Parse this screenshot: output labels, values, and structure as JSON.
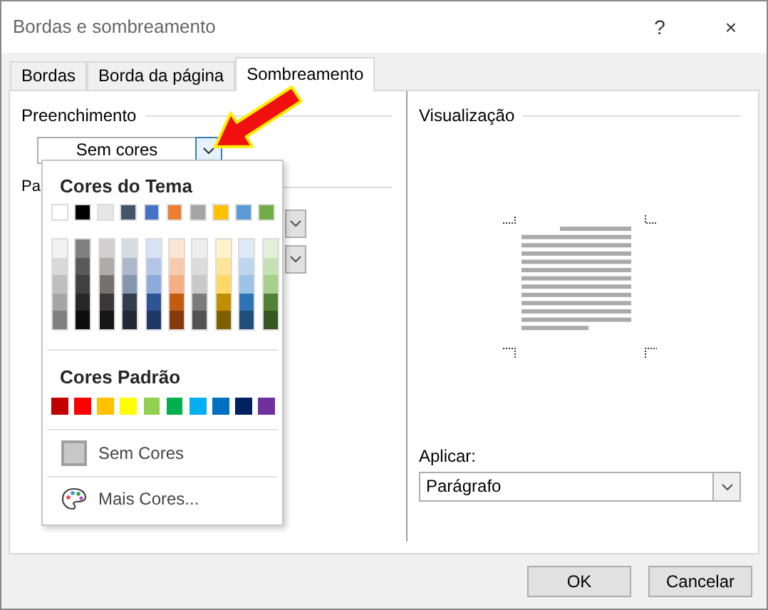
{
  "window": {
    "title": "Bordas e sombreamento",
    "help": "?",
    "close": "×"
  },
  "tabs": [
    {
      "label": "Bordas",
      "selected": false
    },
    {
      "label": "Borda da página",
      "selected": false
    },
    {
      "label": "Sombreamento",
      "selected": true
    }
  ],
  "fill": {
    "label": "Preenchimento",
    "value": "Sem cores",
    "expanded": true
  },
  "pattern": {
    "label": "Pa"
  },
  "color_menu": {
    "theme_heading": "Cores do Tema",
    "theme_colors": [
      {
        "color": "#ffffff",
        "shades": [
          {
            "color": "#f2f2f2"
          },
          {
            "color": "#d9d9d9"
          },
          {
            "color": "#bfbfbf"
          },
          {
            "color": "#a6a6a6"
          },
          {
            "color": "#808080"
          }
        ]
      },
      {
        "color": "#000000",
        "shades": [
          {
            "color": "#808080"
          },
          {
            "color": "#595959"
          },
          {
            "color": "#404040"
          },
          {
            "color": "#262626"
          },
          {
            "color": "#0d0d0d"
          }
        ]
      },
      {
        "color": "#e7e6e6",
        "shades": [
          {
            "color": "#d0cece"
          },
          {
            "color": "#aeabab"
          },
          {
            "color": "#757171"
          },
          {
            "color": "#3a3838"
          },
          {
            "color": "#171616"
          }
        ]
      },
      {
        "color": "#44546a",
        "shades": [
          {
            "color": "#d6dce4"
          },
          {
            "color": "#adb9ca"
          },
          {
            "color": "#8497b0"
          },
          {
            "color": "#333f4f"
          },
          {
            "color": "#222a35"
          }
        ]
      },
      {
        "color": "#4472c4",
        "shades": [
          {
            "color": "#d9e2f3"
          },
          {
            "color": "#b4c6e7"
          },
          {
            "color": "#8eaadb"
          },
          {
            "color": "#2f5496"
          },
          {
            "color": "#1f3864"
          }
        ]
      },
      {
        "color": "#ed7d31",
        "shades": [
          {
            "color": "#fbe5d5"
          },
          {
            "color": "#f7caac"
          },
          {
            "color": "#f4b083"
          },
          {
            "color": "#c55a11"
          },
          {
            "color": "#833c0b"
          }
        ]
      },
      {
        "color": "#a5a5a5",
        "shades": [
          {
            "color": "#ededed"
          },
          {
            "color": "#dbdbdb"
          },
          {
            "color": "#c9c9c9"
          },
          {
            "color": "#7b7b7b"
          },
          {
            "color": "#525252"
          }
        ]
      },
      {
        "color": "#ffc000",
        "shades": [
          {
            "color": "#fff2cc"
          },
          {
            "color": "#fee599"
          },
          {
            "color": "#ffd965"
          },
          {
            "color": "#bf8f00"
          },
          {
            "color": "#7f6000"
          }
        ]
      },
      {
        "color": "#5b9bd5",
        "shades": [
          {
            "color": "#deeaf6"
          },
          {
            "color": "#bdd6ee"
          },
          {
            "color": "#9cc3e5"
          },
          {
            "color": "#2e74b5"
          },
          {
            "color": "#1e4e79"
          }
        ]
      },
      {
        "color": "#70ad47",
        "shades": [
          {
            "color": "#e2efd9"
          },
          {
            "color": "#c5e0b3"
          },
          {
            "color": "#a8d08d"
          },
          {
            "color": "#538135"
          },
          {
            "color": "#375623"
          }
        ]
      }
    ],
    "standard_heading": "Cores Padrão",
    "standard_colors": [
      {
        "color": "#c00000"
      },
      {
        "color": "#ff0000"
      },
      {
        "color": "#ffc000"
      },
      {
        "color": "#ffff00"
      },
      {
        "color": "#92d050"
      },
      {
        "color": "#00b050"
      },
      {
        "color": "#00b0f0"
      },
      {
        "color": "#0070c0"
      },
      {
        "color": "#002060"
      },
      {
        "color": "#7030a0"
      }
    ],
    "no_color": "Sem Cores",
    "more_colors": "Mais Cores..."
  },
  "preview": {
    "label": "Visualização"
  },
  "apply": {
    "label": "Aplicar:",
    "value": "Parágrafo"
  },
  "buttons": [
    "OK",
    "Cancelar"
  ]
}
